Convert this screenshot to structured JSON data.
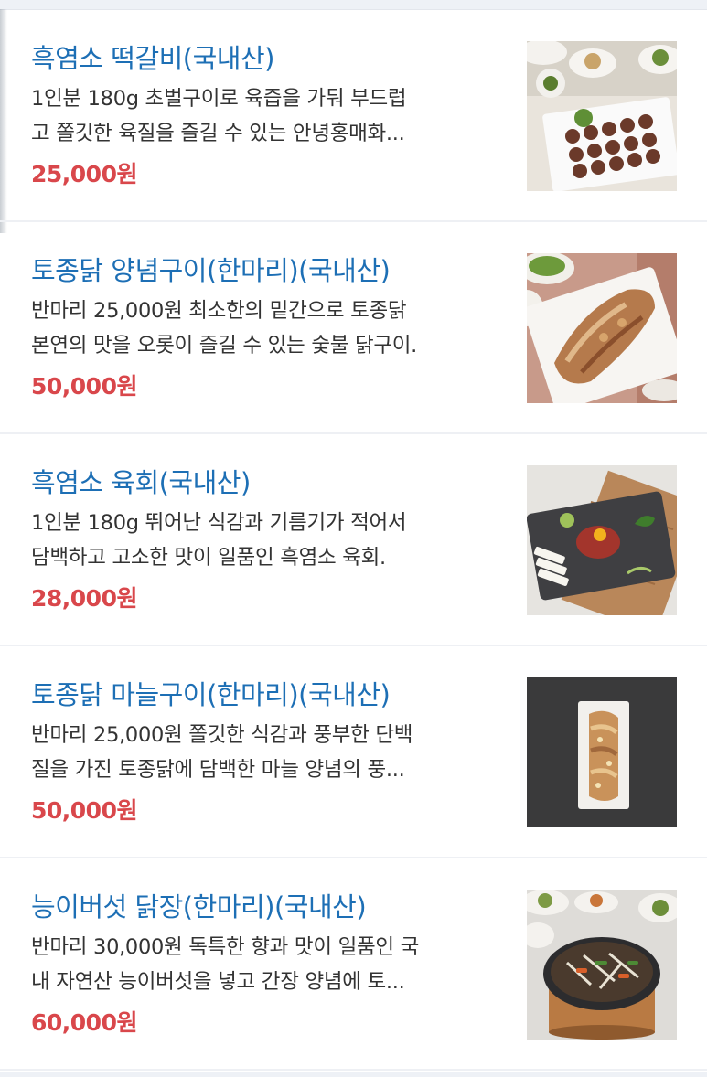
{
  "menu": {
    "items": [
      {
        "title": "흑염소 떡갈비(국내산)",
        "description_lines": [
          "1인분 180g 초벌구이로 육즙을 가둬 부드럽",
          "고 쫄깃한 육질을 즐길 수 있는 안녕홍매화..."
        ],
        "price": "25,000원",
        "image_icon": "grilled-goat-patties-image"
      },
      {
        "title": "토종닭 양념구이(한마리)(국내산)",
        "description_lines": [
          "반마리 25,000원 최소한의 밑간으로 토종닭",
          "본연의 맛을 오롯이 즐길 수 있는 숯불 닭구이."
        ],
        "price": "50,000원",
        "image_icon": "grilled-chicken-image"
      },
      {
        "title": "흑염소 육회(국내산)",
        "description_lines": [
          "1인분 180g 뛰어난 식감과 기름기가 적어서",
          "담백하고 고소한 맛이 일품인 흑염소 육회."
        ],
        "price": "28,000원",
        "image_icon": "goat-tartare-image"
      },
      {
        "title": "토종닭 마늘구이(한마리)(국내산)",
        "description_lines": [
          "반마리 25,000원 쫄깃한 식감과 풍부한 단백",
          "질을 가진 토종닭에 담백한 마늘 양념의 풍..."
        ],
        "price": "50,000원",
        "image_icon": "garlic-chicken-image"
      },
      {
        "title": "능이버섯 닭장(한마리)(국내산)",
        "description_lines": [
          "반마리 30,000원 독특한 향과 맛이 일품인 국",
          "내 자연산 능이버섯을 넣고 간장 양념에 토..."
        ],
        "price": "60,000원",
        "image_icon": "mushroom-chicken-stew-image"
      }
    ]
  },
  "colors": {
    "title": "#1d6fb5",
    "price": "#d9474b",
    "description": "#333333"
  }
}
